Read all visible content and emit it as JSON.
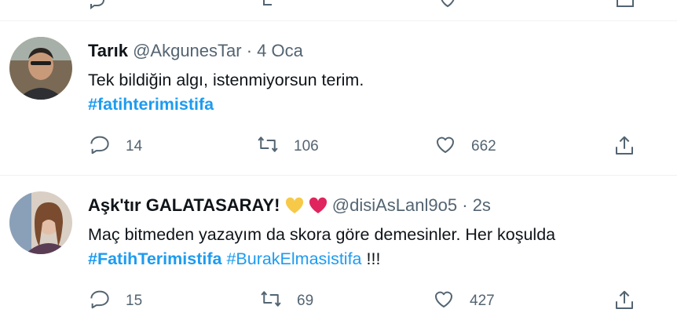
{
  "tweets": [
    {
      "author_name": "Tarık",
      "handle": "@AkgunesTar",
      "separator": "·",
      "time": "4 Oca",
      "text_line1": "Tek bildiğin algı, istenmiyorsun terim.",
      "hashtags_line2": [
        "#fatihterimistifa"
      ],
      "replies": "14",
      "retweets": "106",
      "likes": "662"
    },
    {
      "author_name": "Aşk'tır GALATASARAY!",
      "emoji": [
        "yellow-heart",
        "red-heart"
      ],
      "handle": "@disiAsLanl9o5",
      "separator": "·",
      "time": "2s",
      "text_line1": "Maç bitmeden yazayım da skora göre demesinler. Her koşulda",
      "hashtag_bold": "#FatihTerimistifa",
      "hashtag_plain": "#BurakElmasistifa",
      "trailing": "!!!",
      "replies": "15",
      "retweets": "69",
      "likes": "427"
    }
  ],
  "icons": {
    "reply": "reply-icon",
    "retweet": "retweet-icon",
    "like": "like-icon",
    "share": "share-icon"
  },
  "colors": {
    "hashtag": "#1d9bf0",
    "secondary_text": "#536471",
    "divider": "#eff3f4",
    "yellow_heart": "#f7c948",
    "red_heart": "#e0245e"
  }
}
